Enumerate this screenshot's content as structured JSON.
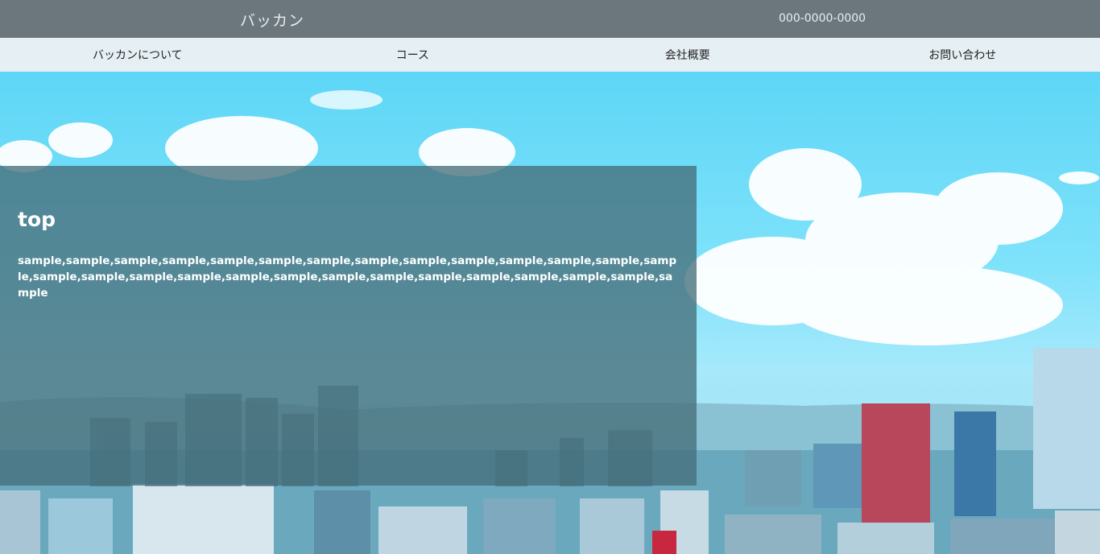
{
  "header": {
    "brand": "バッカン",
    "phone": "000-0000-0000"
  },
  "nav": {
    "items": [
      {
        "label": "バッカンについて"
      },
      {
        "label": "コース"
      },
      {
        "label": "会社概要"
      },
      {
        "label": "お問い合わせ"
      }
    ]
  },
  "hero": {
    "title": "top",
    "body": "sample,sample,sample,sample,sample,sample,sample,sample,sample,sample,sample,sample,sample,sample,sample,sample,sample,sample,sample,sample,sample,sample,sample,sample,sample,sample,sample,sample",
    "colors": {
      "sky": "#5dd6f6",
      "overlay": "#466e7a"
    }
  }
}
